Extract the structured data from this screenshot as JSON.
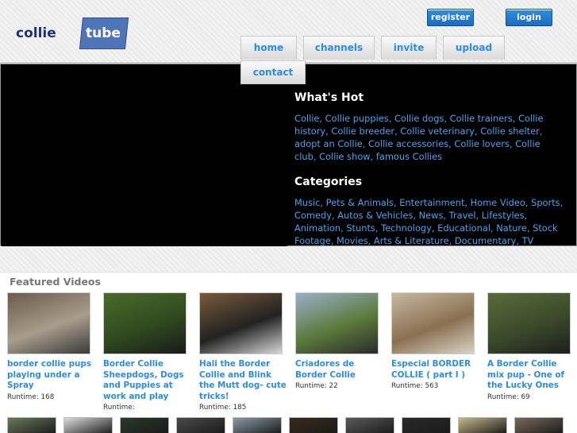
{
  "logo": {
    "part1": "collie",
    "part2": "tube"
  },
  "header": {
    "register_label": "register",
    "login_label": "login"
  },
  "nav": {
    "home": "home",
    "channels": "channels",
    "invite": "invite",
    "upload": "upload",
    "contact": "contact"
  },
  "hero": {
    "whats_hot_title": "What's Hot",
    "whats_hot_links": "Collie, Collie puppies, Collie dogs, Collie trainers, Collie history, Collie breeder, Collie veterinary, Collie shelter, adopt an Collie, Collie accessories, Collie lovers, Collie club, Collie show, famous Collies",
    "categories_title": "Categories",
    "categories_links": "Music, Pets & Animals, Entertainment, Home Video, Sports, Comedy, Autos & Vehicles, News, Travel, Lifestyles, Animation, Stunts, Technology, Educational, Nature, Stock Footage, Movies, Arts & Literature, Documentary, TV"
  },
  "featured": {
    "title": "Featured Videos",
    "videos": [
      {
        "title": "border collie pups playing under a Spray",
        "runtime": "Runtime: 168",
        "thumb_colors": [
          "#6b5b4a",
          "#a89c8a",
          "#3a3a3a"
        ]
      },
      {
        "title": "Border Collie Sheepdogs, Dogs and Puppies at work and play",
        "runtime": "Runtime: ",
        "thumb_colors": [
          "#4a6b2a",
          "#2f4a1e",
          "#1a1a1a"
        ]
      },
      {
        "title": "Hali the Border Collie and Blink the Mutt dog- cute tricks!",
        "runtime": "Runtime: 185",
        "thumb_colors": [
          "#7a5a3a",
          "#222222",
          "#d8d8d8"
        ]
      },
      {
        "title": "Criadores de Border Collie",
        "runtime": "Runtime: 22",
        "thumb_colors": [
          "#9ab0c8",
          "#5a7a3a",
          "#2a2a2a"
        ]
      },
      {
        "title": "Especial BORDER COLLIE ( part I )",
        "runtime": "Runtime: 563",
        "thumb_colors": [
          "#c8b8a0",
          "#8a7050",
          "#d8d4c8"
        ]
      },
      {
        "title": "A Border Collie mix pup - One of the Lucky Ones",
        "runtime": "Runtime: 69",
        "thumb_colors": [
          "#5a6a3a",
          "#3a4a2a",
          "#1e1e1e"
        ]
      }
    ]
  },
  "bottom_row_count": 10
}
